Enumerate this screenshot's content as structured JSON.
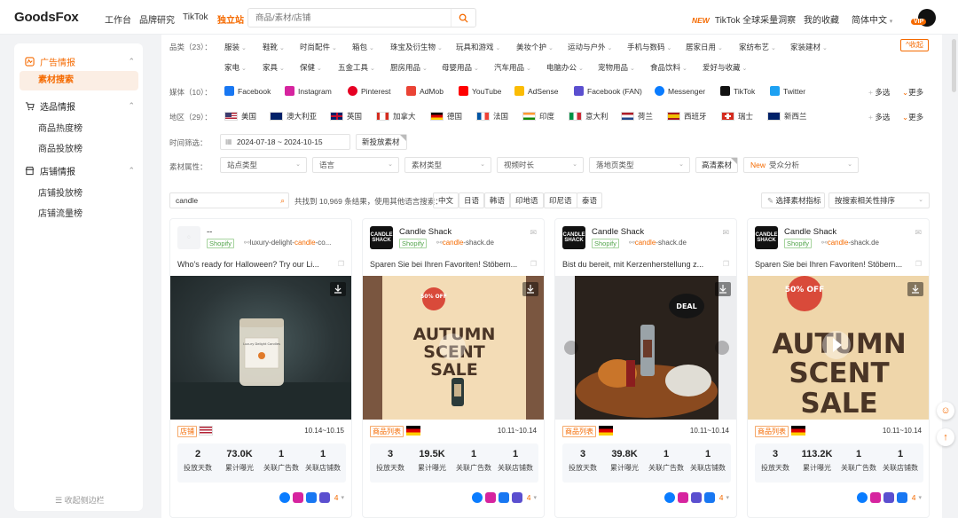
{
  "header": {
    "logo": "GoodsFox",
    "nav": [
      "工作台",
      "品牌研究",
      "TikTok",
      "独立站"
    ],
    "search_placeholder": "商品/素材/店铺",
    "tiktok_promo": "TikTok 全球采量洞察",
    "new_tag": "NEW",
    "favorites": "我的收藏",
    "language": "简体中文",
    "vip": "VIP"
  },
  "sidebar": {
    "ads_intel": "广告情报",
    "material_search": "素材搜索",
    "product_intel": "选品情报",
    "product_hot": "商品热度榜",
    "product_ads": "商品投放榜",
    "store_intel": "店铺情报",
    "store_ads": "店铺投放榜",
    "store_traffic": "店铺流量榜",
    "collapse": "收起侧边栏"
  },
  "filters": {
    "category_label": "品类（23）：",
    "categories_row1": [
      "服装",
      "鞋靴",
      "时尚配件",
      "箱包",
      "珠宝及衍生物",
      "玩具和游戏",
      "美妆个护",
      "运动与户外",
      "手机与数码",
      "居家日用",
      "家纺布艺",
      "家装建材"
    ],
    "categories_row2": [
      "家电",
      "家具",
      "保健",
      "五金工具",
      "厨房用品",
      "母婴用品",
      "汽车用品",
      "电脑办公",
      "宠物用品",
      "食品饮料",
      "爱好与收藏"
    ],
    "collapse_btn": "收起",
    "media_label": "媒体（10）：",
    "media": [
      {
        "name": "Facebook",
        "color": "#1877f2"
      },
      {
        "name": "Instagram",
        "color": "#d6249f"
      },
      {
        "name": "Pinterest",
        "color": "#e60023"
      },
      {
        "name": "AdMob",
        "color": "#ea4335"
      },
      {
        "name": "YouTube",
        "color": "#ff0000"
      },
      {
        "name": "AdSense",
        "color": "#fbbc04"
      },
      {
        "name": "Facebook (FAN)",
        "color": "#5b4fcf"
      },
      {
        "name": "Messenger",
        "color": "#0a7cff"
      },
      {
        "name": "TikTok",
        "color": "#111111"
      },
      {
        "name": "Twitter",
        "color": "#1da1f2"
      }
    ],
    "multi": "多选",
    "more": "更多",
    "region_label": "地区（29）：",
    "regions": [
      "美国",
      "澳大利亚",
      "英国",
      "加拿大",
      "德国",
      "法国",
      "印度",
      "意大利",
      "荷兰",
      "西班牙",
      "瑞士",
      "新西兰"
    ],
    "time_label": "时间筛选：",
    "date_range": "2024-07-18 ~ 2024-10-15",
    "new_material": "新投放素材",
    "attr_label": "素材属性：",
    "attrs": [
      "站点类型",
      "语言",
      "素材类型",
      "视频时长",
      "落地页类型"
    ],
    "hd": "高清素材",
    "new_badge": "New",
    "audience": "受众分析"
  },
  "results": {
    "keyword": "candle",
    "count_text": "共找到 10,969 条结果，使用其他语言搜索：",
    "languages": [
      "中文",
      "日语",
      "韩语",
      "印地语",
      "印尼语",
      "泰语"
    ],
    "choose_metrics": "选择素材指标",
    "sort": "按搜索相关性排序"
  },
  "cards": [
    {
      "name": "--",
      "platform": "Shopify",
      "domain_pre": "luxury-delight-",
      "domain_hl": "candle",
      "domain_post": "-co...",
      "text": "Who's ready for Halloween? Try our Li...",
      "type": "店铺",
      "date": "10.14~10.15",
      "stats": [
        "2",
        "73.0K",
        "1",
        "1"
      ],
      "count": "4"
    },
    {
      "name": "Candle Shack",
      "platform": "Shopify",
      "domain_pre": "",
      "domain_hl": "candle",
      "domain_post": "-shack.de",
      "text": "Sparen Sie bei Ihren Favoriten! Stöbern...",
      "type": "商品列表",
      "date": "10.11~10.14",
      "stats": [
        "3",
        "19.5K",
        "1",
        "1"
      ],
      "count": "4"
    },
    {
      "name": "Candle Shack",
      "platform": "Shopify",
      "domain_pre": "",
      "domain_hl": "candle",
      "domain_post": "-shack.de",
      "text": "Bist du bereit, mit Kerzenherstellung z...",
      "type": "商品列表",
      "date": "10.11~10.14",
      "stats": [
        "3",
        "39.8K",
        "1",
        "1"
      ],
      "count": "4"
    },
    {
      "name": "Candle Shack",
      "platform": "Shopify",
      "domain_pre": "",
      "domain_hl": "candle",
      "domain_post": "-shack.de",
      "text": "Sparen Sie bei Ihren Favoriten! Stöbern...",
      "type": "商品列表",
      "date": "10.11~10.14",
      "stats": [
        "3",
        "113.2K",
        "1",
        "1"
      ],
      "count": "4"
    }
  ],
  "stat_labels": [
    "投放天数",
    "累计曝光",
    "关联广告数",
    "关联店铺数"
  ],
  "logo_text": "CANDLE SHACK",
  "creatives": {
    "badge": "50% OFF",
    "autumn": "AUTUMN",
    "scent": "SCENT",
    "sale": "SALE",
    "deal": "DEAL",
    "jar_label": "Luxury Delight Candles"
  },
  "colors": {
    "accent": "#f56a00"
  }
}
